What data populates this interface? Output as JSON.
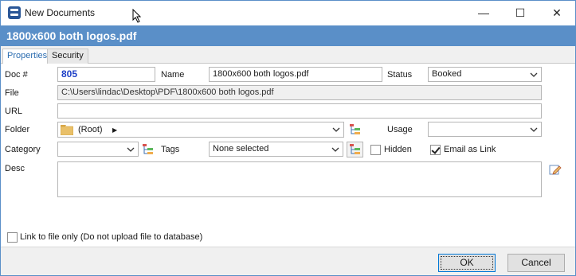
{
  "window": {
    "title": "New Documents",
    "header_title": "1800x600 both logos.pdf",
    "controls": {
      "minimize": "—",
      "maximize": "☐",
      "close": "✕"
    }
  },
  "tabs": [
    {
      "label": "Properties",
      "active": true
    },
    {
      "label": "Security",
      "active": false
    }
  ],
  "form": {
    "doc_no": {
      "label": "Doc #",
      "value": "805"
    },
    "name": {
      "label": "Name",
      "value": "1800x600 both logos.pdf"
    },
    "status": {
      "label": "Status",
      "value": "Booked"
    },
    "file": {
      "label": "File",
      "value": "C:\\Users\\lindac\\Desktop\\PDF\\1800x600 both logos.pdf"
    },
    "url": {
      "label": "URL",
      "value": ""
    },
    "folder": {
      "label": "Folder",
      "value": "(Root)",
      "arrow": "▶"
    },
    "usage": {
      "label": "Usage",
      "value": ""
    },
    "category": {
      "label": "Category",
      "value": ""
    },
    "tags": {
      "label": "Tags",
      "value": "None selected"
    },
    "hidden": {
      "label": "Hidden",
      "checked": false
    },
    "email_as_link": {
      "label": "Email as Link",
      "checked": true
    },
    "desc": {
      "label": "Desc",
      "value": ""
    },
    "link_only": {
      "label": "Link to file only (Do not upload file to database)",
      "checked": false
    }
  },
  "buttons": {
    "ok": "OK",
    "cancel": "Cancel"
  },
  "icons": {
    "folder": "folder-icon",
    "tree": "tree-icon",
    "edit_desc": "edit-icon",
    "app": "app-icon"
  },
  "colors": {
    "accent": "#5a8fc8",
    "doc_number": "#1d3fc7"
  }
}
